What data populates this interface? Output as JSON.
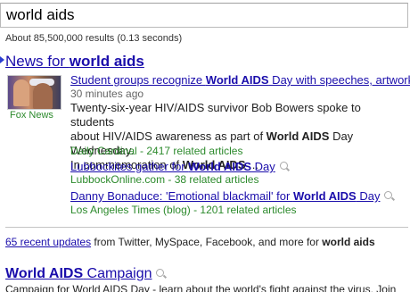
{
  "search": {
    "query": "world aids"
  },
  "stats": {
    "text": "About 85,500,000 results (0.13 seconds)"
  },
  "news": {
    "header_prefix": "News for ",
    "header_bold": "world aids",
    "thumbnail_source": "Fox News",
    "stories": [
      {
        "title_pre": "Student groups recognize ",
        "title_bold": "World AIDS",
        "title_post": " Day with speeches, artwork",
        "time": "30 minutes ago",
        "snippet_line1": "Twenty-six-year HIV/AIDS survivor Bob Bowers spoke to students",
        "snippet_line2_pre": "about HIV/AIDS awareness as part of ",
        "snippet_line2_bold": "World AIDS",
        "snippet_line2_post": " Day Wednesday.",
        "snippet_line3_pre": "In commemoration of ",
        "snippet_line3_bold": "World AIDS",
        "snippet_line3_post": " ...",
        "source": "Daily Cardinal",
        "related_sep": " - ",
        "related": "2417 related articles"
      },
      {
        "title_pre": "Lubbockites gather for ",
        "title_bold": "World AIDS",
        "title_post": " Day",
        "source": "LubbockOnline.com",
        "related_sep": " - ",
        "related": "38 related articles"
      },
      {
        "title_pre": "Danny Bonaduce: 'Emotional blackmail' for ",
        "title_bold": "World AIDS",
        "title_post": " Day",
        "source": "Los Angeles Times (blog)",
        "related_sep": " - ",
        "related": "1201 related articles"
      }
    ]
  },
  "updates": {
    "link": "65 recent updates",
    "text": " from Twitter, MySpace, Facebook, and more for ",
    "bold": "world aids"
  },
  "result": {
    "title_bold": "World AIDS",
    "title_post": " Campaign",
    "snippet_cut": "Campaign for World AIDS Day - learn about the world's fight against the virus. Join the campaign"
  }
}
